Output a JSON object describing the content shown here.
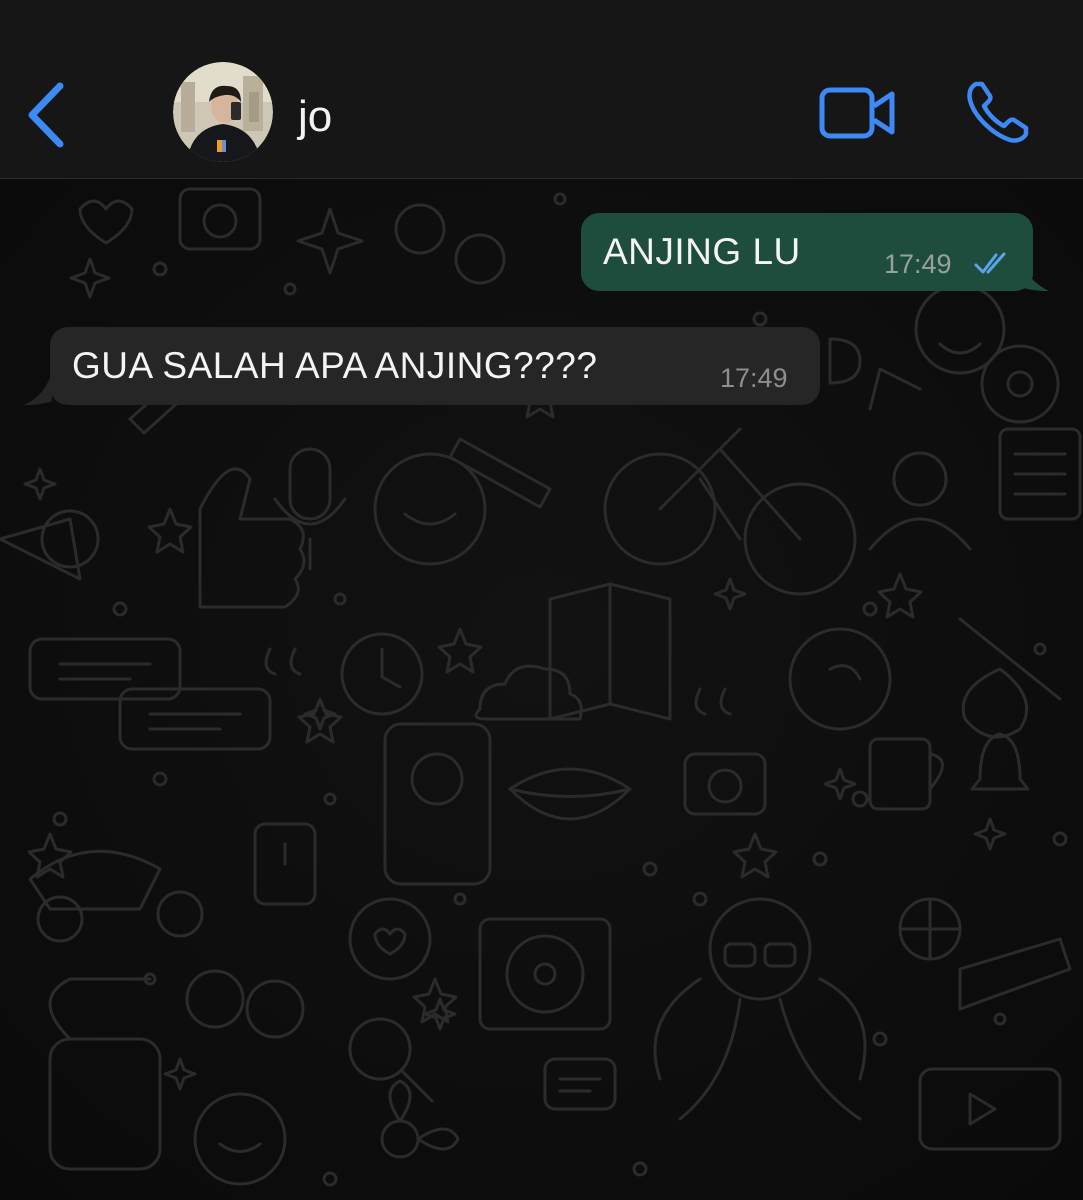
{
  "header": {
    "contact_name": "jo",
    "back_icon": "chevron-left-icon",
    "video_icon": "video-camera-icon",
    "call_icon": "phone-icon",
    "accent_color": "#3d8af7"
  },
  "messages": [
    {
      "direction": "outgoing",
      "text": "ANJING LU",
      "time": "17:49",
      "status": "read",
      "bubble_color": "#1e4d3e"
    },
    {
      "direction": "incoming",
      "text": "GUA SALAH APA ANJING????",
      "time": "17:49",
      "bubble_color": "#262626"
    }
  ]
}
